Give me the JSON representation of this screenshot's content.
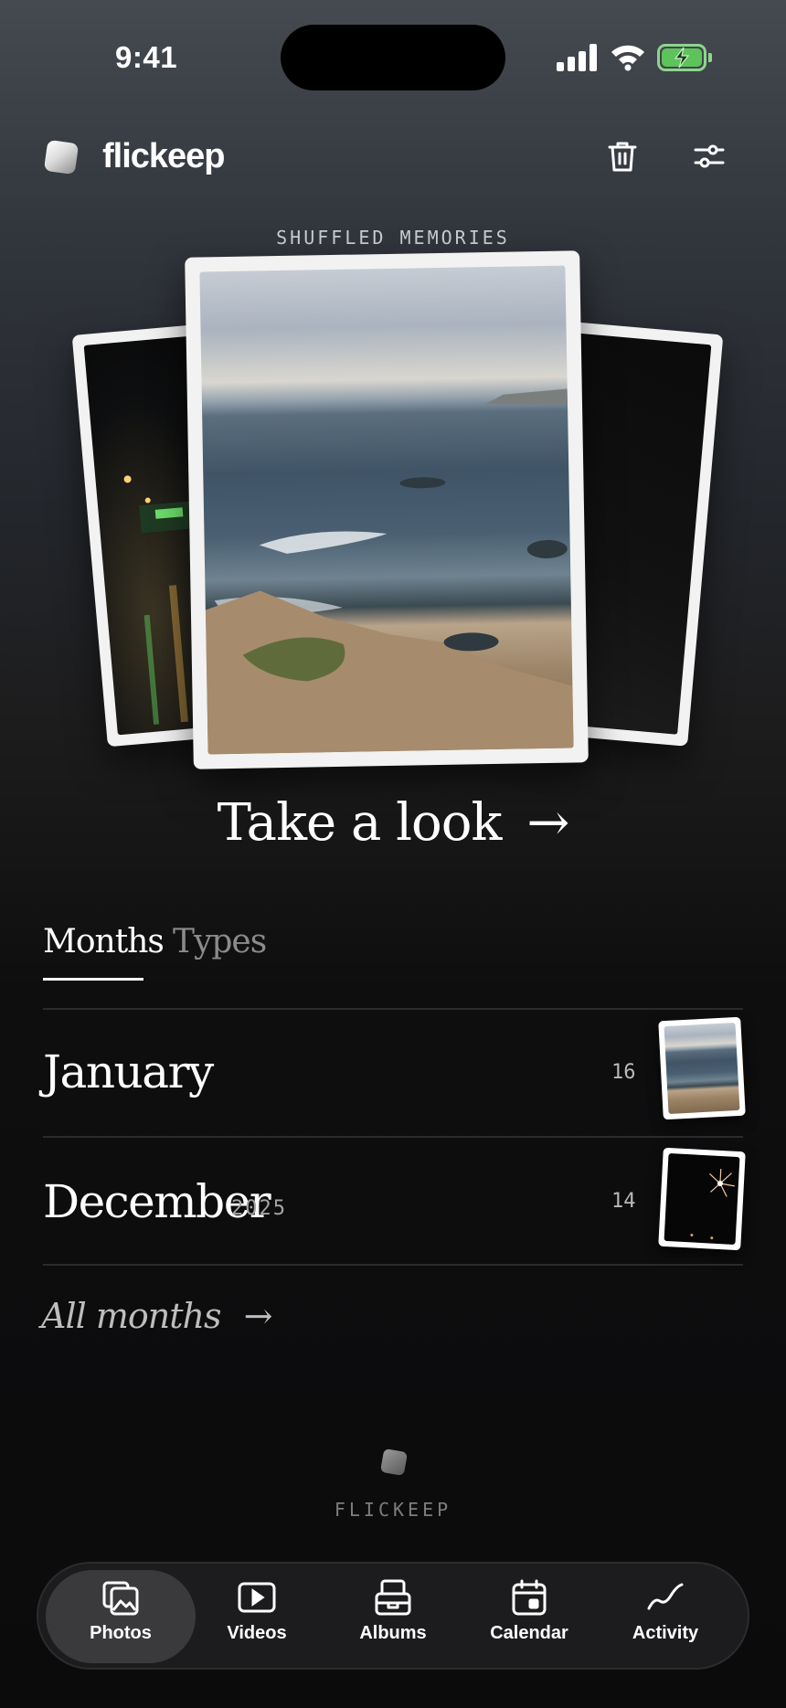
{
  "status_bar": {
    "time": "9:41"
  },
  "header": {
    "app_name": "flickeep"
  },
  "memories": {
    "label": "SHUFFLED MEMORIES",
    "cta": "Take a look",
    "cta_arrow": "→"
  },
  "tabs": [
    {
      "label": "Months",
      "active": true
    },
    {
      "label": "Types",
      "active": false
    }
  ],
  "months": [
    {
      "name": "January",
      "year": "",
      "count": "16"
    },
    {
      "name": "December",
      "year": "2025",
      "count": "14"
    }
  ],
  "all_months": {
    "label": "All months",
    "arrow": "→"
  },
  "footer": {
    "label": "FLICKEEP"
  },
  "tabbar": [
    {
      "label": "Photos",
      "icon": "photos-icon",
      "active": true
    },
    {
      "label": "Videos",
      "icon": "videos-icon",
      "active": false
    },
    {
      "label": "Albums",
      "icon": "albums-icon",
      "active": false
    },
    {
      "label": "Calendar",
      "icon": "calendar-icon",
      "active": false
    },
    {
      "label": "Activity",
      "icon": "activity-icon",
      "active": false
    }
  ],
  "colors": {
    "accent": "#ffffff",
    "battery": "#5ec35a",
    "background": "#0b0b0c"
  }
}
